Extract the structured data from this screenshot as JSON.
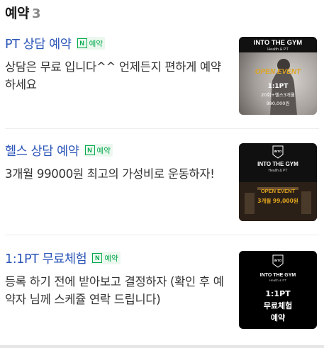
{
  "section": {
    "title": "예약",
    "count": "3"
  },
  "items": [
    {
      "name": "PT 상담 예약",
      "badge": "예약",
      "description": "상담은 무료 입니다^^ 언제든지 편하게 예약하세요",
      "thumb": {
        "brand": "INTO THE GYM",
        "tagline": "Health & PT",
        "event": "OPEN EVENT",
        "offer": "1:1PT",
        "detail": "20회+헬스3개월",
        "price": "990,000원"
      }
    },
    {
      "name": "헬스 상담 예약",
      "badge": "예약",
      "description": "3개월 99000원 최고의 가성비로 운동하자!",
      "thumb": {
        "logo": "INTO",
        "brand": "INTO THE GYM",
        "tagline": "Health & PT",
        "event": "OPEN EVENT",
        "offer": "3개월 99,000원"
      }
    },
    {
      "name": "1:1PT 무료체험",
      "badge": "예약",
      "description": "등록 하기 전에 받아보고 결정하자 (확인 후 예약자 님께 스케쥴 연락 드립니다)",
      "thumb": {
        "logo": "INTO",
        "brand": "INTO THE GYM",
        "tagline": "Health & PT",
        "line1": "1:1PT",
        "line2": "무료체험",
        "line3": "예약"
      }
    }
  ],
  "colors": {
    "link": "#2b55b8",
    "badge_green": "#03a94d",
    "gold": "#e0a41e"
  }
}
